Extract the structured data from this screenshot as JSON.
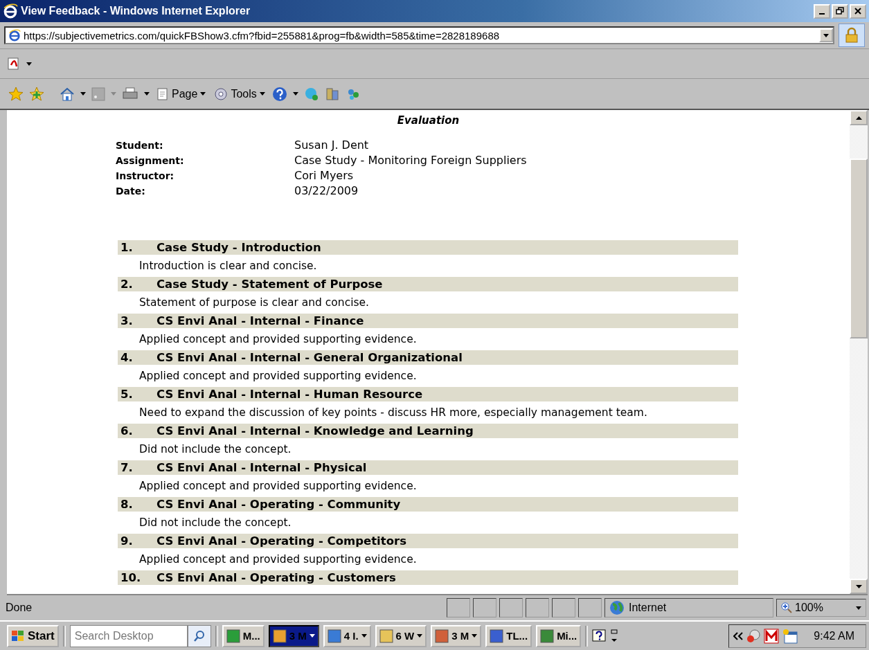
{
  "window": {
    "title": "View Feedback - Windows Internet Explorer"
  },
  "address": {
    "value": "https://subjectivemetrics.com/quickFBShow3.cfm?fbid=255881&prog=fb&width=585&time=2828189688"
  },
  "command_bar": [
    {
      "kind": "page",
      "label": "Page"
    },
    {
      "kind": "tools",
      "label": "Tools"
    }
  ],
  "page": {
    "heading": "Evaluation",
    "info": [
      {
        "label": "Student:",
        "value": "Susan J. Dent"
      },
      {
        "label": "Assignment:",
        "value": "Case Study - Monitoring Foreign Suppliers"
      },
      {
        "label": "Instructor:",
        "value": "Cori Myers"
      },
      {
        "label": "Date:",
        "value": "03/22/2009"
      }
    ],
    "criteria": [
      {
        "number": "1.",
        "title": "Case Study - Introduction",
        "comment": "Introduction is clear and concise."
      },
      {
        "number": "2.",
        "title": "Case Study - Statement of Purpose",
        "comment": "Statement of purpose is clear and concise."
      },
      {
        "number": "3.",
        "title": "CS Envi Anal - Internal - Finance",
        "comment": "Applied concept and provided supporting evidence."
      },
      {
        "number": "4.",
        "title": "CS Envi Anal - Internal - General Organizational",
        "comment": "Applied concept and provided supporting evidence."
      },
      {
        "number": "5.",
        "title": "CS Envi Anal - Internal - Human Resource",
        "comment": "Need to expand the discussion of key points - discuss HR more, especially management team."
      },
      {
        "number": "6.",
        "title": "CS Envi Anal - Internal - Knowledge and Learning",
        "comment": "Did not include the concept."
      },
      {
        "number": "7.",
        "title": "CS Envi Anal - Internal - Physical",
        "comment": "Applied concept and provided supporting evidence."
      },
      {
        "number": "8.",
        "title": "CS Envi Anal - Operating - Community",
        "comment": "Did not include the concept."
      },
      {
        "number": "9.",
        "title": "CS Envi Anal - Operating - Competitors",
        "comment": "Applied concept and provided supporting evidence."
      },
      {
        "number": "10.",
        "title": "CS Envi Anal - Operating - Customers"
      }
    ]
  },
  "status_bar": {
    "text": "Done",
    "zone": "Internet",
    "zoom": "100%"
  },
  "taskbar": {
    "start": "Start",
    "search_placeholder": "Search Desktop",
    "tasks": [
      {
        "label": "M...",
        "selected": false,
        "dropdown": false
      },
      {
        "label": "3 M",
        "selected": true,
        "dropdown": true
      },
      {
        "label": "4 I.",
        "selected": false,
        "dropdown": true
      },
      {
        "label": "6 W",
        "selected": false,
        "dropdown": true
      },
      {
        "label": "3 M",
        "selected": false,
        "dropdown": true
      },
      {
        "label": "TL...",
        "selected": false,
        "dropdown": false
      },
      {
        "label": "Mi...",
        "selected": false,
        "dropdown": false
      }
    ],
    "clock": "9:42 AM"
  }
}
